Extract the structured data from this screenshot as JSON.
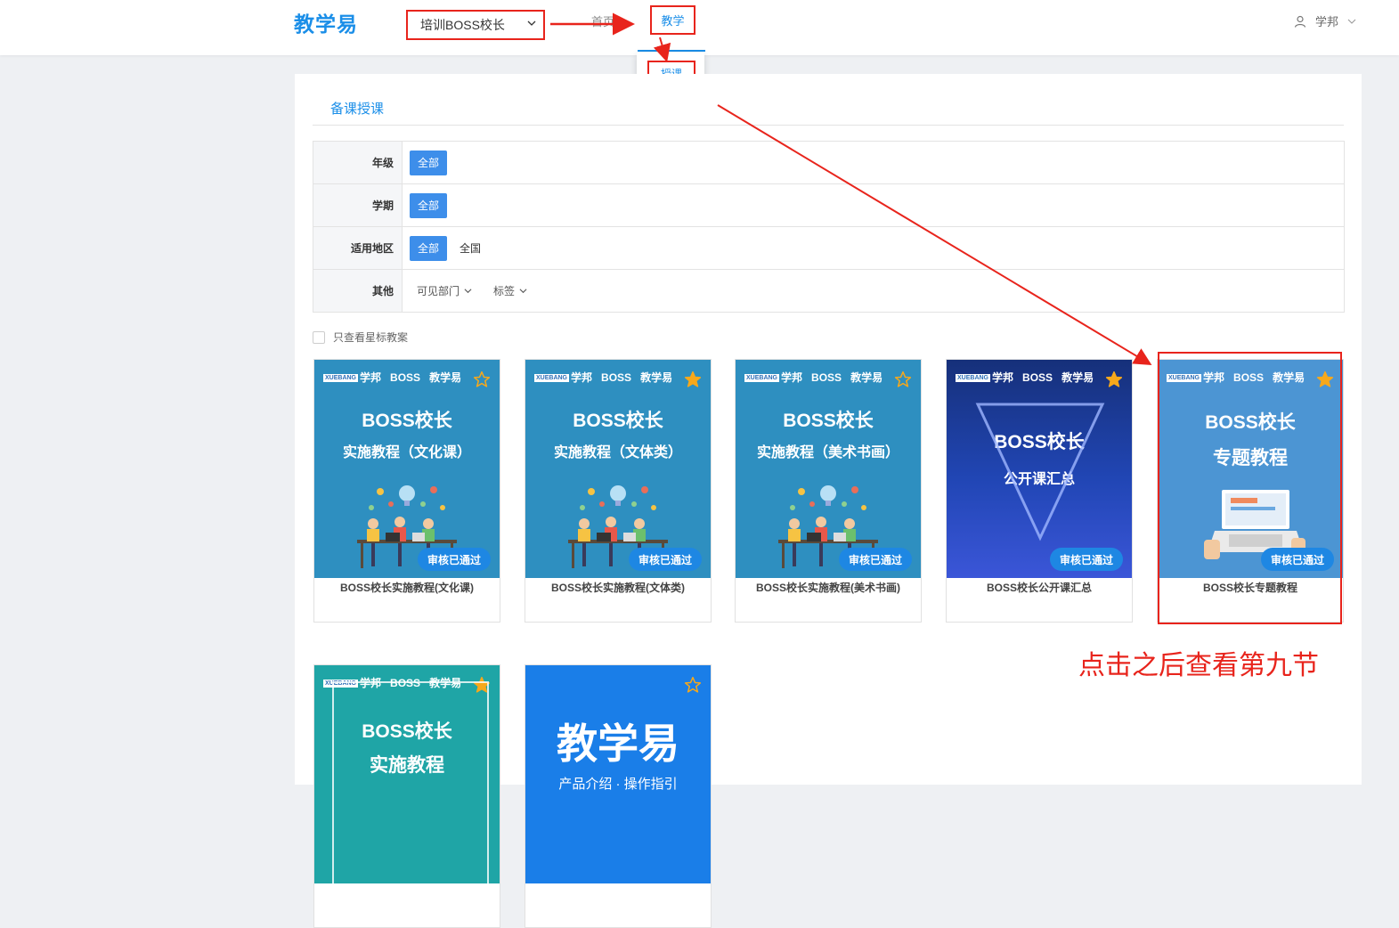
{
  "header": {
    "logo": "教学易",
    "org_select": "培训BOSS校长",
    "nav_home": "首页",
    "nav_teach": "教学",
    "dropdown_item": "授课",
    "user_name": "学邦"
  },
  "section": {
    "title": "备课授课"
  },
  "filters": [
    {
      "label": "年级",
      "tag": "全部"
    },
    {
      "label": "学期",
      "tag": "全部"
    },
    {
      "label": "适用地区",
      "tag": "全部",
      "option": "全国"
    },
    {
      "label": "其他",
      "dropdowns": [
        "可见部门",
        "标签"
      ]
    }
  ],
  "star_filter": "只查看星标教案",
  "brand": {
    "xb": "XUEBANG",
    "a": "学邦",
    "b": "BOSS",
    "c": "教学易"
  },
  "cards": [
    {
      "title1": "BOSS校长",
      "title2": "实施教程（文化课）",
      "badge": "审核已通过",
      "name": "BOSS校长实施教程(文化课)",
      "starred": false
    },
    {
      "title1": "BOSS校长",
      "title2": "实施教程（文体类）",
      "badge": "审核已通过",
      "name": "BOSS校长实施教程(文体类)",
      "starred": true
    },
    {
      "title1": "BOSS校长",
      "title2": "实施教程（美术书画）",
      "badge": "审核已通过",
      "name": "BOSS校长实施教程(美术书画)",
      "starred": false
    },
    {
      "title1": "BOSS校长",
      "title2": "公开课汇总",
      "badge": "审核已通过",
      "name": "BOSS校长公开课汇总",
      "starred": true
    },
    {
      "title1": "BOSS校长",
      "title2": "专题教程",
      "badge": "审核已通过",
      "name": "BOSS校长专题教程",
      "starred": true
    },
    {
      "title1": "BOSS校长",
      "title2": "实施教程",
      "starred": true
    },
    {
      "title1": "教学易",
      "title2": "产品介绍 · 操作指引",
      "starred": false
    }
  ],
  "annotation": "点击之后查看第九节",
  "colors": {
    "accent": "#1a8ee8",
    "highlight": "#e8241c",
    "tag": "#3d8eea"
  }
}
